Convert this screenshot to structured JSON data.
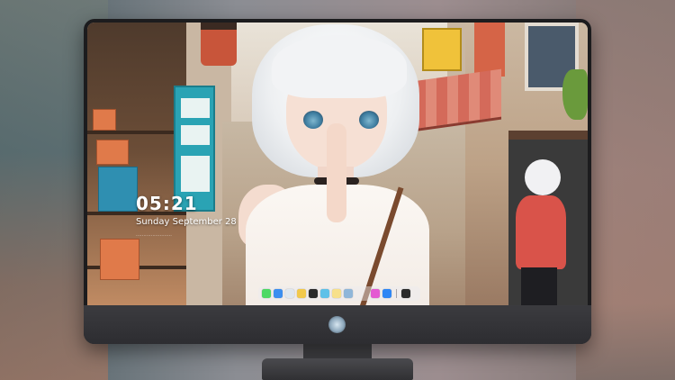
{
  "lockscreen": {
    "time": "05:21",
    "date": "Sunday September 28",
    "subtext": "························"
  },
  "dock": {
    "apps": [
      {
        "name": "messages",
        "icon": "messages-icon",
        "color": "#4cd964"
      },
      {
        "name": "finder",
        "icon": "finder-icon",
        "color": "#3b8ef0"
      },
      {
        "name": "safari",
        "icon": "safari-icon",
        "color": "#dfe7ef"
      },
      {
        "name": "photos",
        "icon": "photos-icon",
        "color": "#f2c94c"
      },
      {
        "name": "claquette",
        "icon": "video-icon",
        "color": "#2a2a2a"
      },
      {
        "name": "files",
        "icon": "folder-icon",
        "color": "#5ec1e8"
      },
      {
        "name": "notes",
        "icon": "notes-icon",
        "color": "#f7e08a"
      },
      {
        "name": "preview",
        "icon": "preview-icon",
        "color": "#8fb6d9"
      },
      {
        "name": "itunes",
        "icon": "music-icon",
        "color": "#e45ad2"
      },
      {
        "name": "app-store",
        "icon": "app-store-icon",
        "color": "#2e86f5"
      },
      {
        "name": "terminal",
        "icon": "terminal-icon",
        "color": "#2b2b2b"
      }
    ]
  }
}
